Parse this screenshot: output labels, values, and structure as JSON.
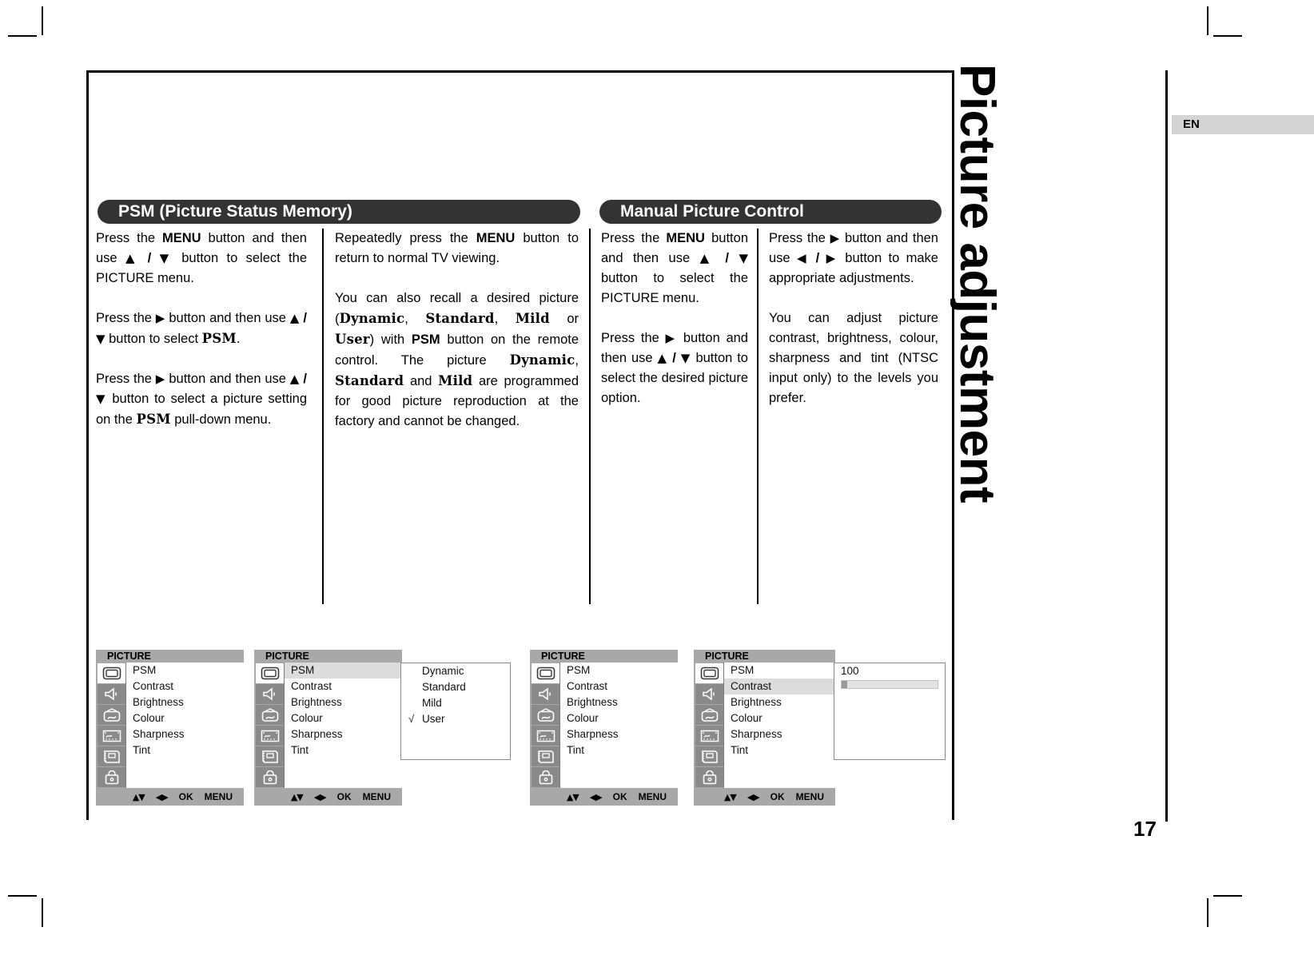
{
  "page": {
    "chapter_title": "Picture adjustment",
    "language_tab": "EN",
    "page_number": "17"
  },
  "sections": [
    {
      "id": "psm",
      "banner": "PSM (Picture Status Memory)"
    },
    {
      "id": "mpc",
      "banner": "Manual Picture Control"
    }
  ],
  "columns": {
    "col1": {
      "paragraphs": [
        "Press the MENU button and then use ▲ / ▼ button to select the PICTURE menu.",
        "Press the ▶ button and then use ▲ / ▼ button to select PSM.",
        "Press the ▶ button and then use ▲ / ▼ button to select a picture setting on the PSM pull-down menu."
      ]
    },
    "col2": {
      "paragraphs": [
        "Repeatedly press the MENU button to return to normal TV viewing.",
        "You can also recall a desired picture (Dynamic, Standard, Mild or User) with PSM button on the remote control. The picture Dynamic, Standard and Mild are programmed for good picture reproduction at the factory and cannot be changed."
      ]
    },
    "col3": {
      "paragraphs": [
        "Press the MENU button and then use ▲ / ▼ button to select the PICTURE menu.",
        "Press the ▶ button and then use ▲ / ▼ button to select the desired picture option."
      ]
    },
    "col4": {
      "paragraphs": [
        "Press the ▶ button and then use ◀ / ▶ button to make appropriate adjustments.",
        "You can adjust picture contrast, brightness, colour, sharpness and tint (NTSC input only) to the levels you prefer."
      ]
    }
  },
  "osd": {
    "title": "PICTURE",
    "menu_items": [
      "PSM",
      "Contrast",
      "Brightness",
      "Colour",
      "Sharpness",
      "Tint"
    ],
    "icons": [
      "picture-icon",
      "sound-icon",
      "channel-icon",
      "screen-icon",
      "special-icon",
      "lock-icon"
    ],
    "footer": {
      "updown": "▲▼",
      "leftright": "◀▶",
      "ok": "OK",
      "menu": "MENU"
    },
    "panels": [
      {
        "name": "panel-picture-menu",
        "highlight": null
      },
      {
        "name": "panel-psm-selected",
        "highlight": "PSM"
      },
      {
        "name": "panel-picture-menu-2",
        "highlight": null
      },
      {
        "name": "panel-contrast-selected",
        "highlight": "Contrast"
      }
    ],
    "psm_options": [
      {
        "label": "Dynamic",
        "checked": false
      },
      {
        "label": "Standard",
        "checked": false
      },
      {
        "label": "Mild",
        "checked": false
      },
      {
        "label": "User",
        "checked": true
      }
    ],
    "check_glyph": "√",
    "contrast_value": "100",
    "contrast_fill_percent": 6
  }
}
